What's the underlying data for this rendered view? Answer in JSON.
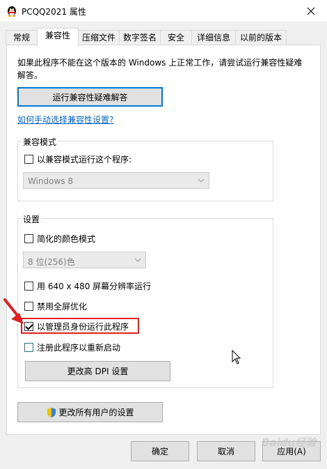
{
  "window": {
    "title": "PCQQ2021 属性"
  },
  "tabs": [
    {
      "label": "常规"
    },
    {
      "label": "兼容性"
    },
    {
      "label": "压缩文件"
    },
    {
      "label": "数字签名"
    },
    {
      "label": "安全"
    },
    {
      "label": "详细信息"
    },
    {
      "label": "以前的版本"
    }
  ],
  "compat": {
    "intro_text": "如果此程序不能在这个版本的 Windows 上正常工作，请尝试运行兼容性疑难解答。",
    "troubleshoot_button": "运行兼容性疑难解答",
    "manual_link": "如何手动选择兼容性设置?",
    "mode_group": {
      "label": "兼容模式",
      "checkbox": "以兼容模式运行这个程序:",
      "checked": false,
      "os_select": "Windows 8"
    },
    "settings_group": {
      "label": "设置",
      "reduced_color": {
        "label": "简化的颜色模式",
        "checked": false
      },
      "color_select": "8 位(256)色",
      "res_640": {
        "label": "用 640 x 480 屏幕分辨率运行",
        "checked": false
      },
      "fullscreen_opt": {
        "label": "禁用全屏优化",
        "checked": false
      },
      "run_as_admin": {
        "label": "以管理员身份运行此程序",
        "checked": true
      },
      "register_restart": {
        "label": "注册此程序以重新启动",
        "checked": false
      },
      "dpi_button": "更改高 DPI 设置"
    },
    "all_users_button": "更改所有用户的设置"
  },
  "footer": {
    "ok": "确定",
    "cancel": "取消",
    "apply": "应用(A)"
  },
  "watermark": "Baidu经验",
  "colors": {
    "accent": "#0078d7",
    "highlight": "#e02020",
    "link": "#0066cc"
  }
}
